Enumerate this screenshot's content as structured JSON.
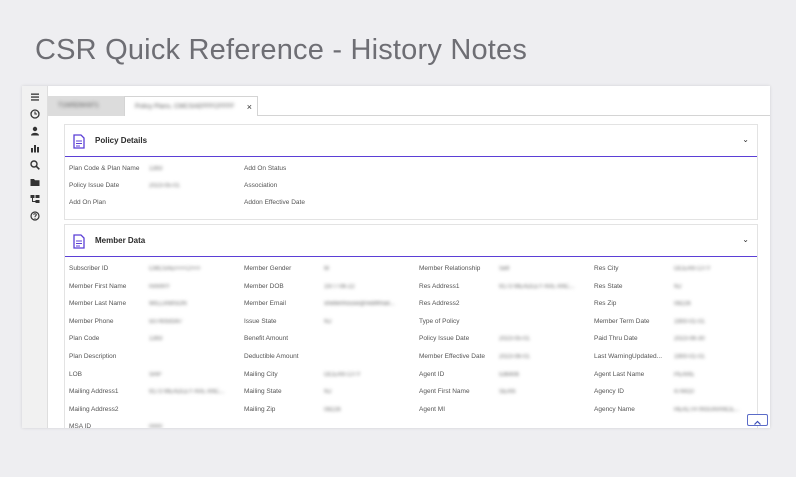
{
  "page_title": "CSR Quick Reference - History Notes",
  "sidebar": {
    "icons": [
      "menu-icon",
      "clock-icon",
      "user-icon",
      "bar-chart-icon",
      "search-icon",
      "folder-icon",
      "hierarchy-icon",
      "help-icon"
    ]
  },
  "tabs": [
    {
      "label": "T1W5D9A971"
    },
    {
      "label": "Policy Plans, CMCSAEFFFCFFFF"
    }
  ],
  "tab_close": "×",
  "policy_details": {
    "title": "Policy Details",
    "chevron": "⌄",
    "fields": [
      {
        "label": "Plan Code & Plan Name",
        "value": "1393"
      },
      {
        "label": "Policy Issue Date",
        "value": "2023-05-01"
      },
      {
        "label": "Add On Plan",
        "value": ""
      },
      {
        "label": "Add On Status",
        "value": ""
      },
      {
        "label": "Association",
        "value": ""
      },
      {
        "label": "Addon Effective Date",
        "value": ""
      }
    ]
  },
  "member_data": {
    "title": "Member Data",
    "chevron": "⌄",
    "col1": [
      {
        "label": "Subscriber ID",
        "value": "CMCSAEFFFCFFF"
      },
      {
        "label": "Member First Name",
        "value": "HARRY"
      },
      {
        "label": "Member Last Name",
        "value": "WILLIAMSON"
      },
      {
        "label": "Member Phone",
        "value": "5074059347"
      },
      {
        "label": "Plan Code",
        "value": "1393"
      },
      {
        "label": "Plan Description",
        "value": ""
      },
      {
        "label": "LOB",
        "value": "SHP"
      },
      {
        "label": "Mailing Address1",
        "value": "9173 MEADLEY AVE ANC..."
      },
      {
        "label": "Mailing Address2",
        "value": ""
      },
      {
        "label": "MSA ID",
        "value": "0000"
      }
    ],
    "col2": [
      {
        "label": "Member Gender",
        "value": "M"
      },
      {
        "label": "Member DOB",
        "value": "1977-06-22"
      },
      {
        "label": "Member Email",
        "value": "shellenhouse@rediffmail..."
      },
      {
        "label": "Issue State",
        "value": "NJ"
      },
      {
        "label": "Benefit Amount",
        "value": ""
      },
      {
        "label": "Deductible Amount",
        "value": ""
      },
      {
        "label": "Mailing City",
        "value": "OCEAN CITY"
      },
      {
        "label": "Mailing State",
        "value": "NJ"
      },
      {
        "label": "Mailing Zip",
        "value": "08226"
      }
    ],
    "col3": [
      {
        "label": "Member Relationship",
        "value": "Self"
      },
      {
        "label": "Res Address1",
        "value": "9173 MEADLEY AVE ANC..."
      },
      {
        "label": "Res Address2",
        "value": ""
      },
      {
        "label": "Type of Policy",
        "value": ""
      },
      {
        "label": "Policy Issue Date",
        "value": "2023-05-01"
      },
      {
        "label": "Member Effective Date",
        "value": "2023-06-01"
      },
      {
        "label": "Agent ID",
        "value": "536406"
      },
      {
        "label": "Agent First Name",
        "value": "SEAN"
      },
      {
        "label": "Agent MI",
        "value": ""
      }
    ],
    "col4": [
      {
        "label": "Res City",
        "value": "OCEAN CITY"
      },
      {
        "label": "Res State",
        "value": "NJ"
      },
      {
        "label": "Res Zip",
        "value": "08226"
      },
      {
        "label": "Member Term Date",
        "value": "1900-01-01"
      },
      {
        "label": "Paid Thru Date",
        "value": "2023-06-30"
      },
      {
        "label": "Last WarningUpdated...",
        "value": "1900-01-01"
      },
      {
        "label": "Agent Last Name",
        "value": "PEARE"
      },
      {
        "label": "Agency ID",
        "value": "474410"
      },
      {
        "label": "Agency Name",
        "value": "HEALTH INSURANCE..."
      }
    ]
  },
  "colors": {
    "accent": "#5b3fd6",
    "icon_purple": "#5b3fd6"
  }
}
